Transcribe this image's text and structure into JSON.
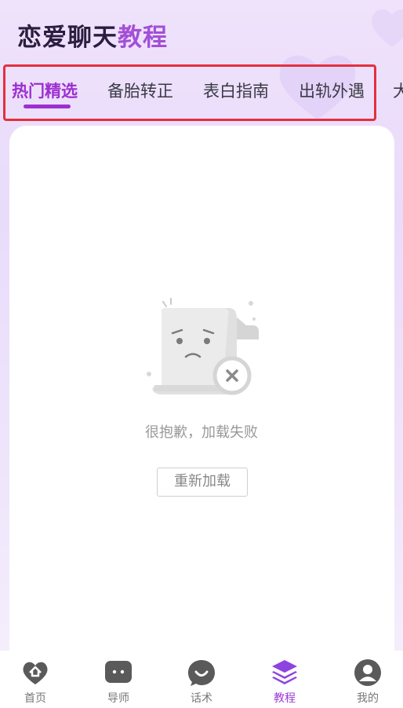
{
  "header": {
    "title_prefix": "恋爱聊天",
    "title_accent": "教程"
  },
  "tabs": [
    {
      "label": "热门精选",
      "active": true
    },
    {
      "label": "备胎转正",
      "active": false
    },
    {
      "label": "表白指南",
      "active": false
    },
    {
      "label": "出轨外遇",
      "active": false
    },
    {
      "label": "大",
      "active": false
    }
  ],
  "content": {
    "error_message": "很抱歉，加载失败",
    "reload_label": "重新加载",
    "illustration_icon": "broken-document-icon"
  },
  "bottom_nav": [
    {
      "label": "首页",
      "icon": "home-heart-icon",
      "active": false
    },
    {
      "label": "导师",
      "icon": "chat-bubble-icon",
      "active": false
    },
    {
      "label": "话术",
      "icon": "smile-bubble-icon",
      "active": false
    },
    {
      "label": "教程",
      "icon": "layers-icon",
      "active": true
    },
    {
      "label": "我的",
      "icon": "user-icon",
      "active": false
    }
  ],
  "colors": {
    "accent": "#9d2fd0",
    "highlight_border": "#e4303d",
    "nav_active": "#9d3ad6"
  }
}
